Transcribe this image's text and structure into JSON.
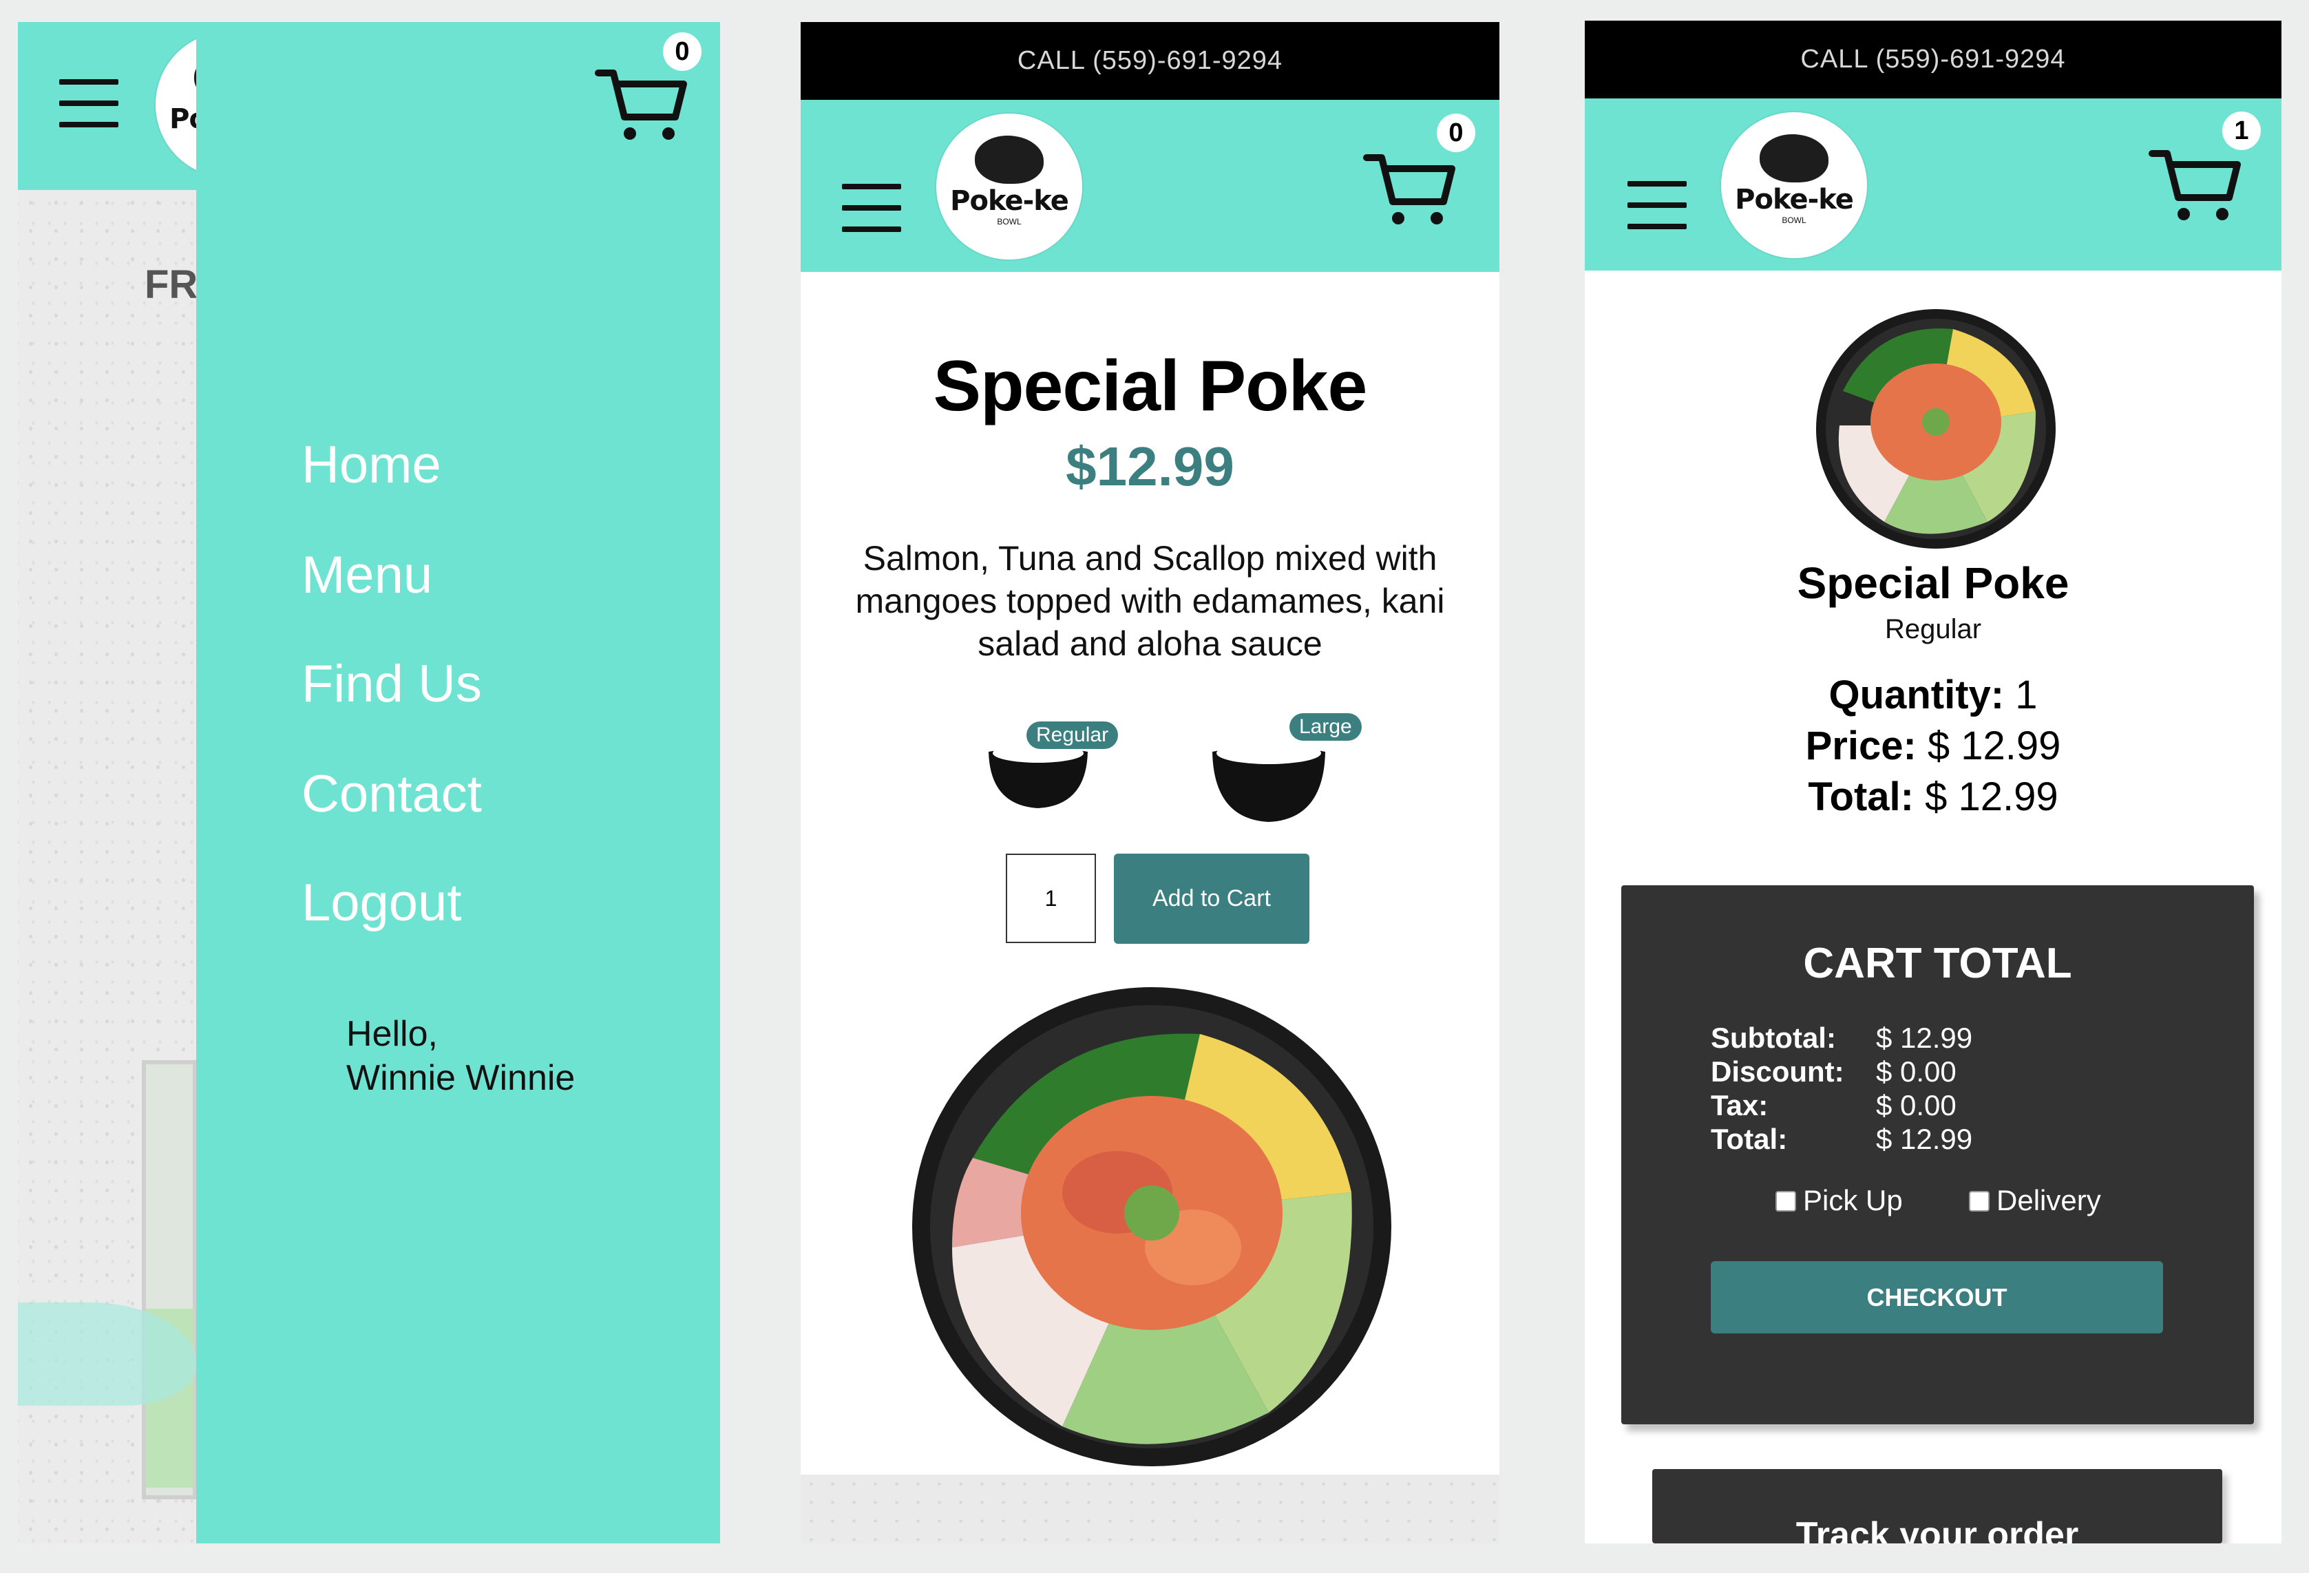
{
  "brand": {
    "logo_text": "Poke-ke",
    "logo_sub": "BOWL"
  },
  "colors": {
    "teal": "#6fe3d1",
    "accent": "#3b7f80",
    "dark_box": "#333333"
  },
  "panel1": {
    "cart_count": "0",
    "background_text": "FR",
    "nav": [
      "Home",
      "Menu",
      "Find Us",
      "Contact",
      "Logout"
    ],
    "greeting_line1": "Hello,",
    "greeting_line2": "Winnie Winnie"
  },
  "panel2": {
    "call_bar": "CALL (559)-691-9294",
    "cart_count": "0",
    "title": "Special Poke",
    "price": "$12.99",
    "description": "Salmon, Tuna and Scallop mixed with mangoes topped with edamames, kani salad and aloha sauce",
    "sizes": [
      "Regular",
      "Large"
    ],
    "quantity": "1",
    "add_button": "Add to Cart"
  },
  "panel3": {
    "call_bar": "CALL (559)-691-9294",
    "cart_count": "1",
    "item_name": "Special Poke",
    "item_size": "Regular",
    "quantity_label": "Quantity:",
    "quantity_value": "1",
    "price_label": "Price:",
    "price_value": "$ 12.99",
    "total_label": "Total:",
    "total_value": "$ 12.99",
    "cart_total": {
      "title": "CART TOTAL",
      "rows": [
        {
          "label": "Subtotal:",
          "value": "$ 12.99"
        },
        {
          "label": "Discount:",
          "value": "$ 0.00"
        },
        {
          "label": "Tax:",
          "value": "$ 0.00"
        },
        {
          "label": "Total:",
          "value": "$ 12.99"
        }
      ],
      "pickup": "Pick Up",
      "delivery": "Delivery",
      "checkout": "CHECKOUT"
    },
    "track_order": "Track your order"
  }
}
